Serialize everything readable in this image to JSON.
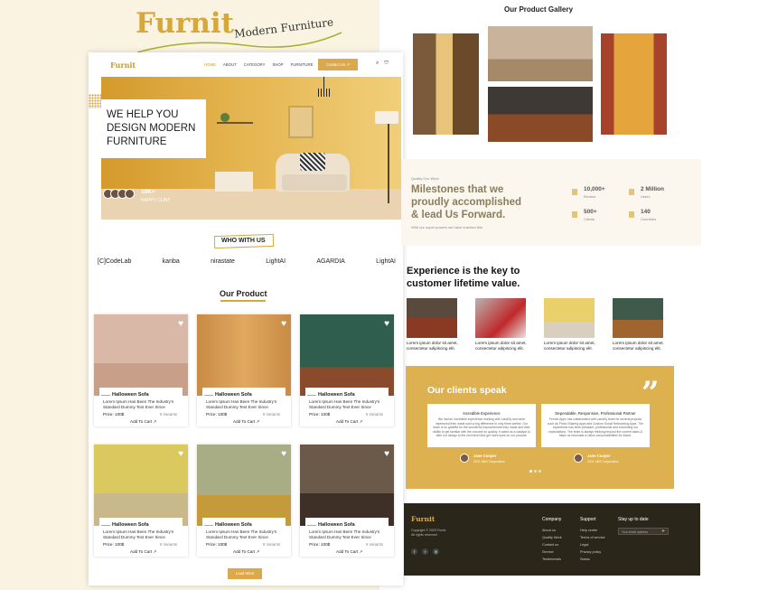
{
  "brand": {
    "title": "Furnit",
    "subtitle": "Modern Furniture"
  },
  "nav": {
    "logo": "Furnit",
    "links": [
      "HOME",
      "ABOUT",
      "CATEGORY",
      "SHOP",
      "FURNITURE"
    ],
    "contact": "Contact Us ↗"
  },
  "hero": {
    "heading": "WE HELP YOU DESIGN MODERN FURNITURE",
    "clients_count": "10K+",
    "clients_label": "HAPPY CLINT"
  },
  "who": {
    "title": "WHO WITH US",
    "brands": [
      "[C]CodeLab",
      "kanba",
      "nirastate",
      "LightAI",
      "AGARDIA",
      "LightAI"
    ]
  },
  "products": {
    "title": "Our Product",
    "items": [
      {
        "name": "Halloween Sofa",
        "desc": "Lorem Ipsum Has Been The Industry's Standard Dummy Text Ever Since",
        "price": "Price: 100$",
        "variants": "5 Variants",
        "cart": "Add To Cart ↗"
      },
      {
        "name": "Halloween Sofa",
        "desc": "Lorem Ipsum Has Been The Industry's Standard Dummy Text Ever Since",
        "price": "Price: 100$",
        "variants": "5 Variants",
        "cart": "Add To Cart ↗"
      },
      {
        "name": "Halloween Sofa",
        "desc": "Lorem Ipsum Has Been The Industry's Standard Dummy Text Ever Since",
        "price": "Price: 100$",
        "variants": "5 Variants",
        "cart": "Add To Cart ↗"
      },
      {
        "name": "Halloween Sofa",
        "desc": "Lorem Ipsum Has Been The Industry's Standard Dummy Text Ever Since",
        "price": "Price: 100$",
        "variants": "5 Variants",
        "cart": "Add To Cart ↗"
      },
      {
        "name": "Halloween Sofa",
        "desc": "Lorem Ipsum Has Been The Industry's Standard Dummy Text Ever Since",
        "price": "Price: 100$",
        "variants": "5 Variants",
        "cart": "Add To Cart ↗"
      },
      {
        "name": "Halloween Sofa",
        "desc": "Lorem Ipsum Has Been The Industry's Standard Dummy Text Ever Since",
        "price": "Price: 100$",
        "variants": "5 Variants",
        "cart": "Add To Cart ↗"
      }
    ],
    "load_more": "Load More"
  },
  "gallery": {
    "title": "Our Product Gallery"
  },
  "milestones": {
    "eyebrow": "Quality Our Work",
    "title": "Milestones that we proudly accomplished & lead Us Forward.",
    "sub": "With our super powers we have reached this",
    "stats": [
      {
        "value": "10,000+",
        "label": "Review"
      },
      {
        "value": "2 Million",
        "label": "Users"
      },
      {
        "value": "500+",
        "label": "Clients"
      },
      {
        "value": "140",
        "label": "Countries"
      }
    ]
  },
  "experience": {
    "title": "Experience is the key to customer lifetime value.",
    "items": [
      "Lorem ipsum dolor sit amet, consectetur adipiscing elit.",
      "Lorem ipsum dolor sit amet, consectetur adipiscing elit.",
      "Lorem ipsum dolor sit amet, consectetur adipiscing elit.",
      "Lorem ipsum dolor sit amet, consectetur adipiscing elit."
    ]
  },
  "clients": {
    "title": "Our clients speak",
    "testimonials": [
      {
        "title": "Incredible Experience",
        "body": "We had an incredible experience working with LandSy and were impressed they made such a big difference in only three weeks. Our team is so grateful for the wonderful improvements they made and their ability to get familiar with the concept so quickly. It acted as a catalyst to take our design to the next level and get more eyes on our product.",
        "name": "Jane Cooper",
        "role": "CEO, ABC Corporation"
      },
      {
        "title": "Dependable, Responsive, Professional Partner",
        "body": "Fermin Apps has collaborated with LandSy team for several projects such as Photo Sharing Apps and Custom Social Networking Apps. The experience has been pleasant, professional and exceeding our expectations. The team is always thinking beyond the current tasks & helps us formulate a vision and possibilities for future.",
        "name": "Jane Cooper",
        "role": "CEO, ABC Corporation"
      }
    ]
  },
  "footer": {
    "logo": "Furnit",
    "copy": "Copyright © 2023 Furnit. All rights reserved",
    "company": {
      "head": "Company",
      "links": [
        "About us",
        "Quality Work",
        "Contact us",
        "Service",
        "Testimonials"
      ]
    },
    "support": {
      "head": "Support",
      "links": [
        "Help center",
        "Terms of service",
        "Legal",
        "Privacy policy",
        "Status"
      ]
    },
    "newsletter": {
      "head": "Stay up to date",
      "placeholder": "Your email address"
    }
  },
  "colors": {
    "accent": "#dba94c",
    "cream": "#fbf3e2",
    "footer": "#2a261a"
  }
}
